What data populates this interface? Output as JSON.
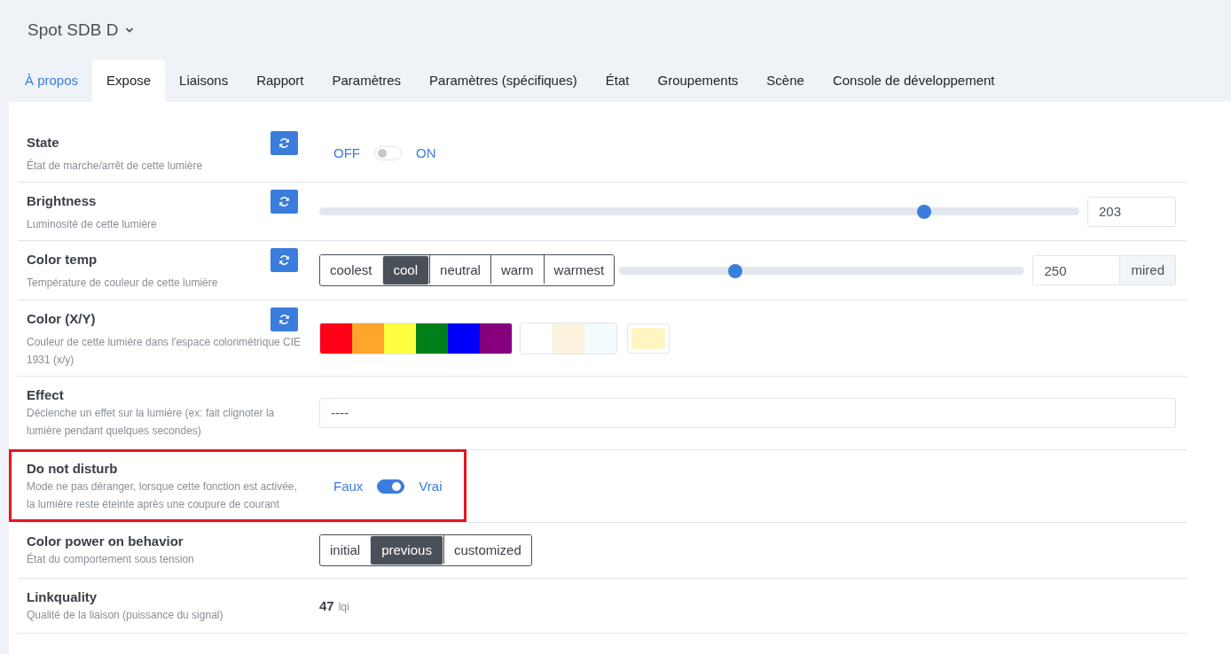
{
  "header": {
    "title": "Spot SDB D"
  },
  "tabs": [
    {
      "label": "À propos",
      "kind": "link",
      "selected": false
    },
    {
      "label": "Expose",
      "kind": "tab",
      "selected": true
    },
    {
      "label": "Liaisons",
      "kind": "tab",
      "selected": false
    },
    {
      "label": "Rapport",
      "kind": "tab",
      "selected": false
    },
    {
      "label": "Paramètres",
      "kind": "tab",
      "selected": false
    },
    {
      "label": "Paramètres (spécifiques)",
      "kind": "tab",
      "selected": false
    },
    {
      "label": "État",
      "kind": "tab",
      "selected": false
    },
    {
      "label": "Groupements",
      "kind": "tab",
      "selected": false
    },
    {
      "label": "Scène",
      "kind": "tab",
      "selected": false
    },
    {
      "label": "Console de développement",
      "kind": "tab",
      "selected": false
    }
  ],
  "rows": [
    {
      "kind": "toggle",
      "label": "State",
      "description": "État de marche/arrêt de cette lumière",
      "refresh": true,
      "highlighted": false,
      "off_label": "OFF",
      "on_label": "ON",
      "on": false
    },
    {
      "kind": "slider",
      "label": "Brightness",
      "description": "Luminosité de cette lumière",
      "refresh": true,
      "highlighted": false,
      "level": 0.796,
      "value": "203"
    },
    {
      "kind": "options_slider",
      "label": "Color temp",
      "description": "Température de couleur de cette lumière",
      "refresh": true,
      "highlighted": false,
      "options": [
        {
          "label": "coolest",
          "selected": false
        },
        {
          "label": "cool",
          "selected": true
        },
        {
          "label": "neutral",
          "selected": false
        },
        {
          "label": "warm",
          "selected": false
        },
        {
          "label": "warmest",
          "selected": false
        }
      ],
      "level": 0.285,
      "value": "250",
      "unit": "mired"
    },
    {
      "kind": "swatches",
      "label": "Color (X/Y)",
      "description": "Couleur de cette lumière dans l'espace colorimétrique CIE 1931 (x/y)",
      "refresh": true,
      "highlighted": false,
      "groups": [
        {
          "kind": "strip",
          "swatches": [
            {
              "color": "#ff0018"
            },
            {
              "color": "#ffa52c"
            },
            {
              "color": "#ffff41"
            },
            {
              "color": "#008018"
            },
            {
              "color": "#0000f9"
            },
            {
              "color": "#86007d"
            }
          ]
        },
        {
          "kind": "strip",
          "swatches": [
            {
              "color": "#ffffff"
            },
            {
              "color": "#fcf3de"
            },
            {
              "color": "#f4fbfd"
            }
          ]
        },
        {
          "kind": "current",
          "swatches": [
            {
              "color": "#fff5c2"
            }
          ]
        }
      ]
    },
    {
      "kind": "select",
      "label": "Effect",
      "description": "Déclenche un effet sur la lumière (ex: fait clignoter la lumière pendant quelques secondes)",
      "refresh": false,
      "highlighted": false,
      "value": "----"
    },
    {
      "kind": "toggle",
      "label": "Do not disturb",
      "description": "Mode ne pas déranger, lorsque cette fonction est activée, la lumière reste éteinte après une coupure de courant",
      "refresh": false,
      "highlighted": true,
      "off_label": "Faux",
      "on_label": "Vrai",
      "on": true
    },
    {
      "kind": "options",
      "label": "Color power on behavior",
      "description": "État du comportement sous tension",
      "refresh": false,
      "highlighted": false,
      "options": [
        {
          "label": "initial",
          "selected": false
        },
        {
          "label": "previous",
          "selected": true
        },
        {
          "label": "customized",
          "selected": false
        }
      ]
    },
    {
      "kind": "reading",
      "label": "Linkquality",
      "description": "Qualité de la liaison (puissance du signal)",
      "refresh": false,
      "highlighted": false,
      "value": "47",
      "unit": "lqi"
    }
  ]
}
